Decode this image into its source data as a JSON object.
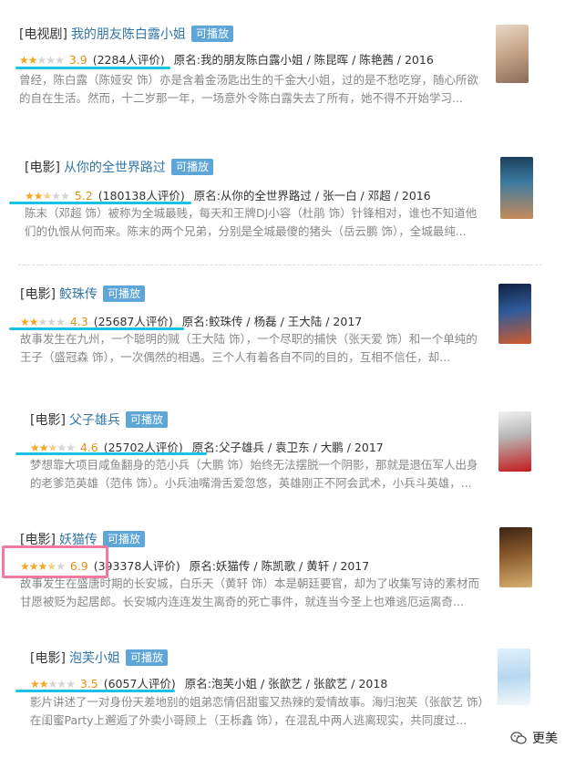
{
  "items": [
    {
      "category": "[电视剧]",
      "title": "我的朋友陈白露小姐",
      "badge": "可播放",
      "stars_filled": 2,
      "rating": "3.9",
      "votes": "(2284人评价)",
      "meta": "原名:我的朋友陈白露小姐 / 陈昆晖 / 陈艳茜 / 2016",
      "desc": "曾经，陈白露（陈娅安 饰）亦是含着金汤匙出生的千金大小姐，过的是不愁吃穿，随心所欲的自在生活。然而，十二岁那一年，一场意外令陈白露失去了所有，她不得不开始学习..."
    },
    {
      "category": "[电影]",
      "title": "从你的全世界路过",
      "badge": "可播放",
      "stars_filled": 2.5,
      "rating": "5.2",
      "votes": "(180138人评价)",
      "meta": "原名:从你的全世界路过 / 张一白 / 邓超 / 2016",
      "desc": "陈末（邓超 饰）被称为全城最贱，每天和王牌DJ小容（杜鹃 饰）针锋相对，谁也不知道他们的仇恨从何而来。陈末的两个兄弟，分别是全城最傻的猪头（岳云鹏 饰），全城最纯..."
    },
    {
      "category": "[电影]",
      "title": "鲛珠传",
      "badge": "可播放",
      "stars_filled": 2,
      "rating": "4.3",
      "votes": "(25687人评价)",
      "meta": "原名:鲛珠传 / 杨磊 / 王大陆 / 2017",
      "desc": "故事发生在九州，一个聪明的贼（王大陆 饰），一个尽职的捕快（张天爱 饰）和一个单纯的王子（盛冠森 饰），一次偶然的相遇。三个人有着各自不同的目的，互相不信任，却..."
    },
    {
      "category": "[电影]",
      "title": "父子雄兵",
      "badge": "可播放",
      "stars_filled": 2.5,
      "rating": "4.6",
      "votes": "(25702人评价)",
      "meta": "原名:父子雄兵 / 袁卫东 / 大鹏 / 2017",
      "desc": "梦想靠大项目咸鱼翻身的范小兵（大鹏 饰）始终无法摆脱一个阴影，那就是退伍军人出身的老爹范英雄（范伟 饰）。小兵油嘴滑舌爱忽悠，英雄刚正不阿会武术，小兵斗英雄，..."
    },
    {
      "category": "[电影]",
      "title": "妖猫传",
      "badge": "可播放",
      "stars_filled": 3.5,
      "rating": "6.9",
      "votes": "(393378人评价)",
      "meta": "原名:妖猫传 / 陈凯歌 / 黄轩 / 2017",
      "desc": "故事发生在盛唐时期的长安城，白乐天（黄轩 饰）本是朝廷要官，却为了收集写诗的素材而甘愿被贬为起居郎。长安城内连连发生离奇的死亡事件，就连当今圣上也难逃厄运离奇..."
    },
    {
      "category": "[电影]",
      "title": "泡芙小姐",
      "badge": "可播放",
      "stars_filled": 2,
      "rating": "3.5",
      "votes": "(6057人评价)",
      "meta": "原名:泡芙小姐 / 张歆艺 / 张歆艺 / 2018",
      "desc": "影片讲述了一对身份天差地别的姐弟恋情侣甜蜜又热辣的爱情故事。海归泡芙（张歆艺 饰）在闺蜜Party上邂逅了外卖小哥顾上（王栎鑫 饰），在混乱中两人逃离现实，共同度过..."
    }
  ],
  "watermark": "更美",
  "colors": {
    "title_link": "#3377aa",
    "badge_bg": "#5fa6d8",
    "star": "#f5a623",
    "underline": "#19c2e4",
    "highlight_box": "#f07aa0"
  }
}
